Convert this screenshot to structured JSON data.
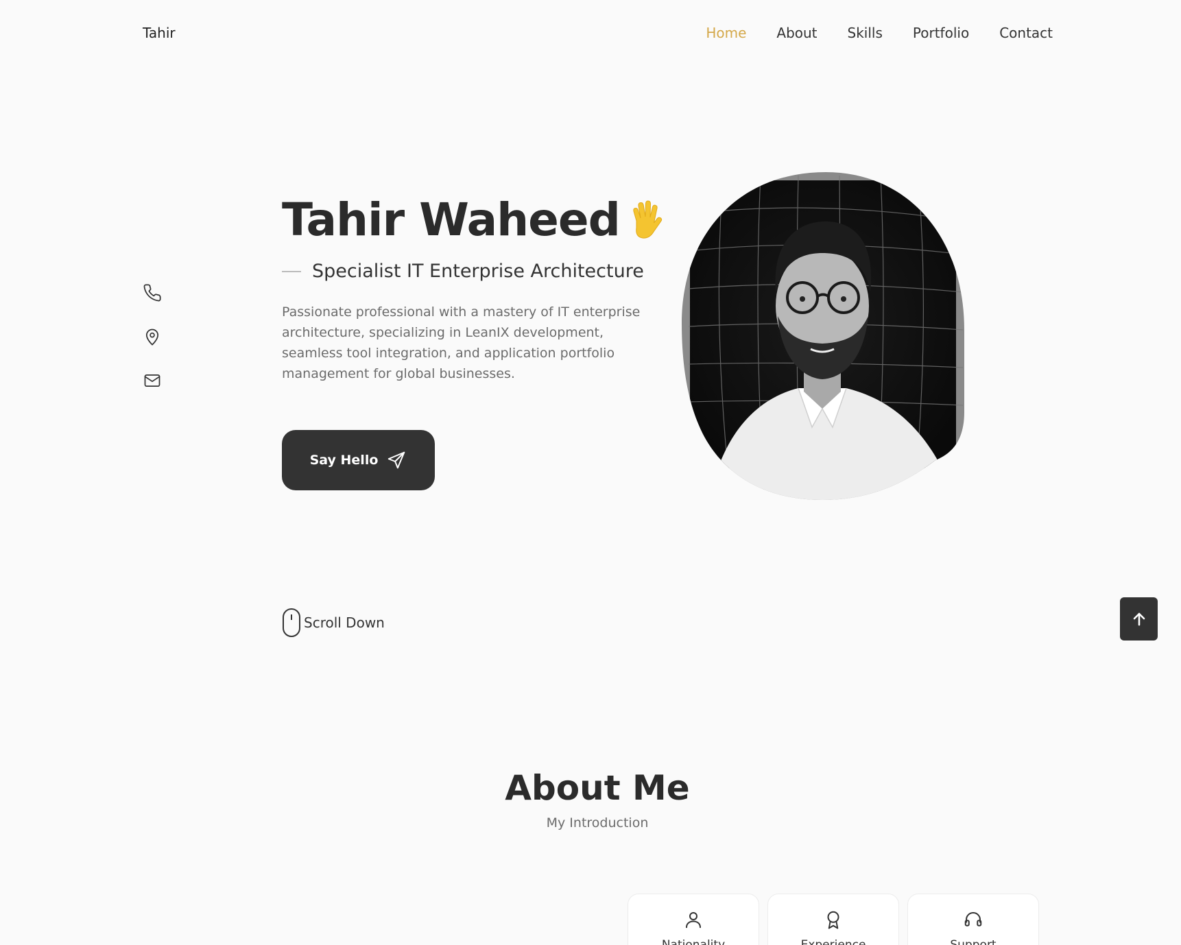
{
  "header": {
    "logo": "Tahir",
    "nav": [
      {
        "label": "Home",
        "active": true
      },
      {
        "label": "About"
      },
      {
        "label": "Skills"
      },
      {
        "label": "Portfolio"
      },
      {
        "label": "Contact"
      }
    ],
    "accent_color": "#d4a84a"
  },
  "social": {
    "icons": [
      "phone-icon",
      "location-pin-icon",
      "mail-icon"
    ]
  },
  "hero": {
    "name": "Tahir Waheed",
    "subtitle": "Specialist IT Enterprise Architecture",
    "description": "Passionate professional with a mastery of IT enterprise architecture, specializing in LeanIX development, seamless tool integration, and application portfolio management for global businesses.",
    "cta_label": "Say Hello",
    "scroll_label": "Scroll Down"
  },
  "about": {
    "title": "About Me",
    "subtitle": "My Introduction",
    "cards": [
      {
        "icon": "user-icon",
        "label": "Nationality"
      },
      {
        "icon": "award-icon",
        "label": "Experience"
      },
      {
        "icon": "headset-icon",
        "label": "Support"
      }
    ]
  }
}
